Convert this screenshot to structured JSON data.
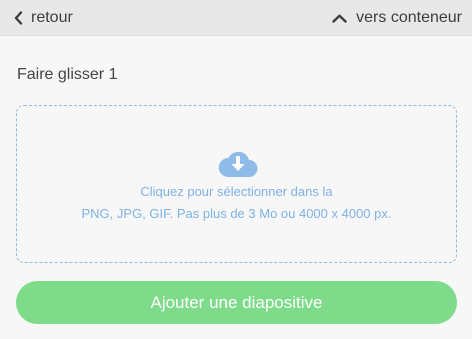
{
  "header": {
    "back_label": "retour",
    "up_label": "vers conteneur",
    "back_icon": "chevron-left-icon",
    "up_icon": "chevron-up-icon"
  },
  "slide": {
    "title": "Faire glisser 1"
  },
  "upload": {
    "icon": "cloud-download-icon",
    "line1": "Cliquez pour sélectionner dans la",
    "line2": "PNG, JPG, GIF. Pas plus de 3 Mo ou 4000 x 4000 px."
  },
  "actions": {
    "add_slide_label": "Ajouter une diapositive"
  },
  "colors": {
    "accent_blue": "#7fb2e5",
    "button_green": "#7ddb8a",
    "header_bg": "#e8e8e8"
  }
}
